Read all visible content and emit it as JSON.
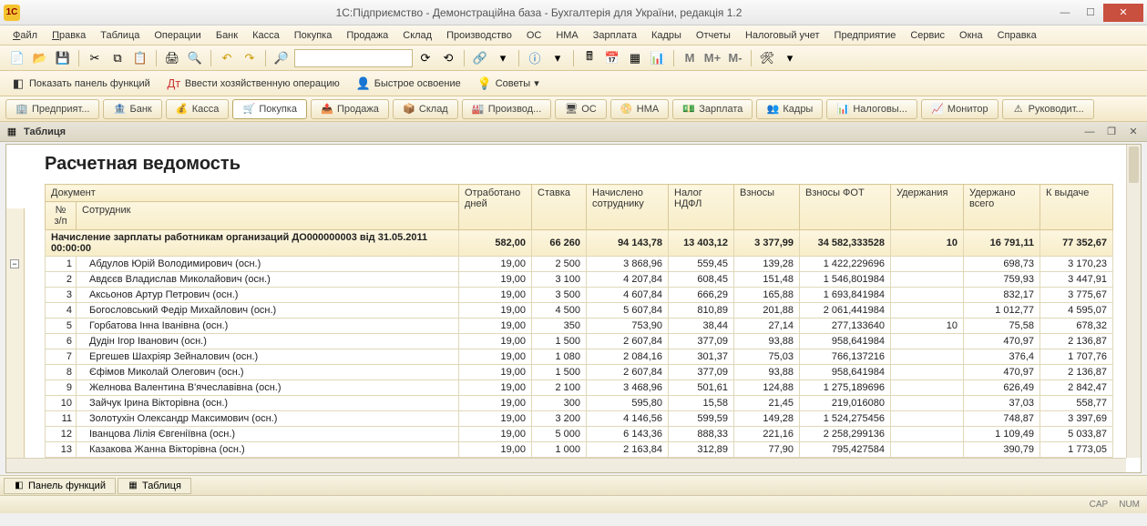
{
  "title": "1С:Підприємство - Демонстраційна база - Бухгалтерія для України, редакція 1.2",
  "menu": [
    "Файл",
    "Правка",
    "Таблица",
    "Операции",
    "Банк",
    "Касса",
    "Покупка",
    "Продажа",
    "Склад",
    "Производство",
    "ОС",
    "НМА",
    "Зарплата",
    "Кадры",
    "Отчеты",
    "Налоговый учет",
    "Предприятие",
    "Сервис",
    "Окна",
    "Справка"
  ],
  "toolbar2": {
    "panel": "Показать панель функций",
    "oper": "Ввести хозяйственную операцию",
    "quick": "Быстрое освоение",
    "tips": "Советы"
  },
  "navtabs": [
    "Предприят...",
    "Банк",
    "Касса",
    "Покупка",
    "Продажа",
    "Склад",
    "Производ...",
    "ОС",
    "НМА",
    "Зарплата",
    "Кадры",
    "Налоговы...",
    "Монитор",
    "Руководит..."
  ],
  "navtab_active": 3,
  "doc_title": "Таблиця",
  "report_title": "Расчетная ведомость",
  "headers": {
    "doc": "Документ",
    "num": "№ з/п",
    "emp": "Сотрудник",
    "days": "Отработано дней",
    "rate": "Ставка",
    "charged": "Начислено сотруднику",
    "tax": "Налог НДФЛ",
    "fee": "Взносы",
    "fot": "Взносы ФОТ",
    "hold": "Удержания",
    "heldtot": "Удержано всего",
    "pay": "К выдаче"
  },
  "total": {
    "desc": "Начисление зарплаты работникам организаций ДО000000003 від 31.05.2011 00:00:00",
    "days": "582,00",
    "rate": "66 260",
    "charged": "94 143,78",
    "tax": "13 403,12",
    "fee": "3 377,99",
    "fot": "34 582,333528",
    "hold": "10",
    "heldtot": "16 791,11",
    "pay": "77 352,67"
  },
  "rows": [
    {
      "n": "1",
      "emp": "Абдулов Юрій Володимирович (осн.)",
      "days": "19,00",
      "rate": "2 500",
      "charged": "3 868,96",
      "tax": "559,45",
      "fee": "139,28",
      "fot": "1 422,229696",
      "hold": "",
      "heldtot": "698,73",
      "pay": "3 170,23"
    },
    {
      "n": "2",
      "emp": "Авдєєв Владислав Миколайович (осн.)",
      "days": "19,00",
      "rate": "3 100",
      "charged": "4 207,84",
      "tax": "608,45",
      "fee": "151,48",
      "fot": "1 546,801984",
      "hold": "",
      "heldtot": "759,93",
      "pay": "3 447,91"
    },
    {
      "n": "3",
      "emp": "Аксьонов Артур Петрович (осн.)",
      "days": "19,00",
      "rate": "3 500",
      "charged": "4 607,84",
      "tax": "666,29",
      "fee": "165,88",
      "fot": "1 693,841984",
      "hold": "",
      "heldtot": "832,17",
      "pay": "3 775,67"
    },
    {
      "n": "4",
      "emp": "Богословський Федір Михайлович (осн.)",
      "days": "19,00",
      "rate": "4 500",
      "charged": "5 607,84",
      "tax": "810,89",
      "fee": "201,88",
      "fot": "2 061,441984",
      "hold": "",
      "heldtot": "1 012,77",
      "pay": "4 595,07"
    },
    {
      "n": "5",
      "emp": "Горбатова Інна Іванівна (осн.)",
      "days": "19,00",
      "rate": "350",
      "charged": "753,90",
      "tax": "38,44",
      "fee": "27,14",
      "fot": "277,133640",
      "hold": "10",
      "heldtot": "75,58",
      "pay": "678,32"
    },
    {
      "n": "6",
      "emp": "Дудін Ігор Іванович (осн.)",
      "days": "19,00",
      "rate": "1 500",
      "charged": "2 607,84",
      "tax": "377,09",
      "fee": "93,88",
      "fot": "958,641984",
      "hold": "",
      "heldtot": "470,97",
      "pay": "2 136,87"
    },
    {
      "n": "7",
      "emp": "Ергешев Шахріяр Зейналович (осн.)",
      "days": "19,00",
      "rate": "1 080",
      "charged": "2 084,16",
      "tax": "301,37",
      "fee": "75,03",
      "fot": "766,137216",
      "hold": "",
      "heldtot": "376,4",
      "pay": "1 707,76"
    },
    {
      "n": "8",
      "emp": "Єфімов Миколай Олегович (осн.)",
      "days": "19,00",
      "rate": "1 500",
      "charged": "2 607,84",
      "tax": "377,09",
      "fee": "93,88",
      "fot": "958,641984",
      "hold": "",
      "heldtot": "470,97",
      "pay": "2 136,87"
    },
    {
      "n": "9",
      "emp": "Желнова Валентина В'ячеславівна (осн.)",
      "days": "19,00",
      "rate": "2 100",
      "charged": "3 468,96",
      "tax": "501,61",
      "fee": "124,88",
      "fot": "1 275,189696",
      "hold": "",
      "heldtot": "626,49",
      "pay": "2 842,47"
    },
    {
      "n": "10",
      "emp": "Зайчук Ірина Вікторівна (осн.)",
      "days": "19,00",
      "rate": "300",
      "charged": "595,80",
      "tax": "15,58",
      "fee": "21,45",
      "fot": "219,016080",
      "hold": "",
      "heldtot": "37,03",
      "pay": "558,77"
    },
    {
      "n": "11",
      "emp": "Золотухін Олександр Максимович (осн.)",
      "days": "19,00",
      "rate": "3 200",
      "charged": "4 146,56",
      "tax": "599,59",
      "fee": "149,28",
      "fot": "1 524,275456",
      "hold": "",
      "heldtot": "748,87",
      "pay": "3 397,69"
    },
    {
      "n": "12",
      "emp": "Іванцова Лілія Євгеніївна (осн.)",
      "days": "19,00",
      "rate": "5 000",
      "charged": "6 143,36",
      "tax": "888,33",
      "fee": "221,16",
      "fot": "2 258,299136",
      "hold": "",
      "heldtot": "1 109,49",
      "pay": "5 033,87"
    },
    {
      "n": "13",
      "emp": "Казакова Жанна Вікторівна (осн.)",
      "days": "19,00",
      "rate": "1 000",
      "charged": "2 163,84",
      "tax": "312,89",
      "fee": "77,90",
      "fot": "795,427584",
      "hold": "",
      "heldtot": "390,79",
      "pay": "1 773,05"
    }
  ],
  "statusbar_tabs": [
    "Панель функций",
    "Таблиця"
  ],
  "statusbar": {
    "cap": "CAP",
    "num": "NUM"
  }
}
